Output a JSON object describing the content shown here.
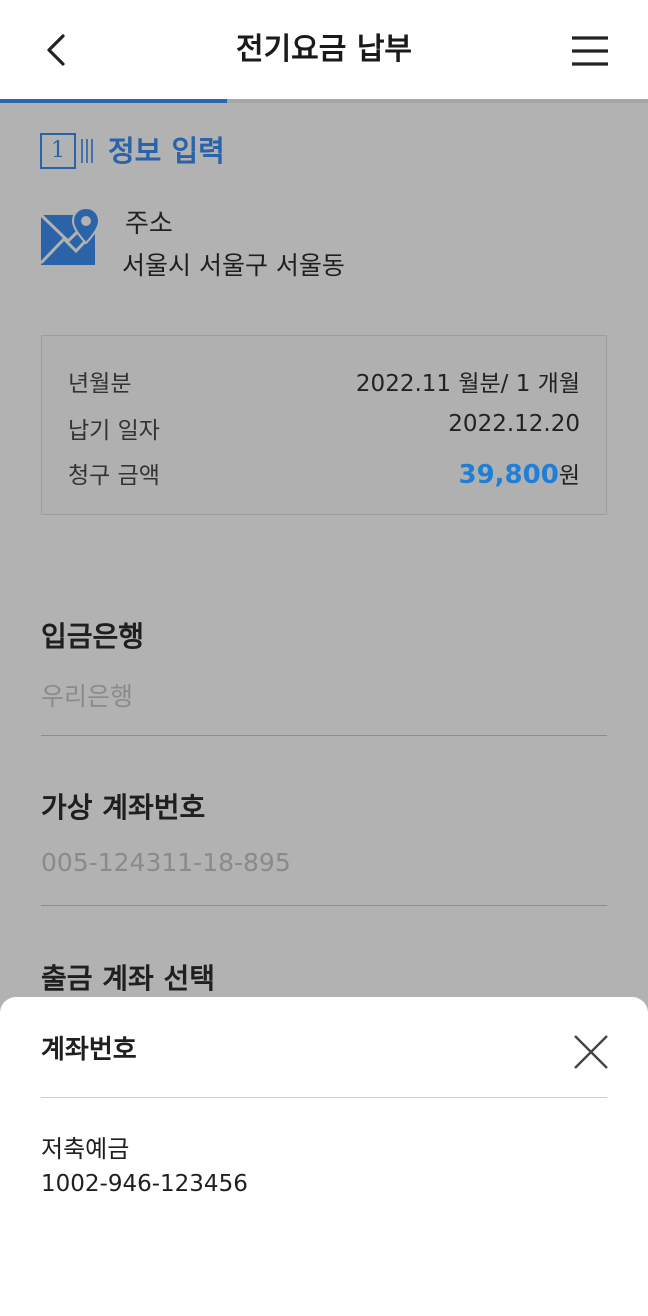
{
  "header": {
    "title": "전기요금 납부",
    "back_icon": "chevron-left-icon",
    "menu_icon": "hamburger-menu-icon",
    "progress_fraction": 0.35
  },
  "step": {
    "number": "1",
    "title": "정보 입력"
  },
  "address": {
    "icon": "map-location-icon",
    "label": "주소",
    "value": "서울시 서울구 서울동"
  },
  "bill_info": {
    "period_label": "년월분",
    "period_value": "2022.11 월분/ 1 개월",
    "due_label": "납기 일자",
    "due_value": "2022.12.20",
    "amount_label": "청구 금액",
    "amount_value": "39,800",
    "amount_unit": "원"
  },
  "fields": {
    "bank_label": "입금은행",
    "bank_value": "우리은행",
    "virtual_label": "가상 계좌번호",
    "virtual_value": "005-124311-18-895",
    "withdraw_label": "출금 계좌 선택"
  },
  "sheet": {
    "title": "계좌번호",
    "close_icon": "close-icon",
    "accounts": [
      {
        "name": "저축예금",
        "number": "1002-946-123456"
      }
    ]
  },
  "colors": {
    "accent": "#2b63a8",
    "amount": "#1f7fd6",
    "overlay": "#b2b2b2"
  }
}
